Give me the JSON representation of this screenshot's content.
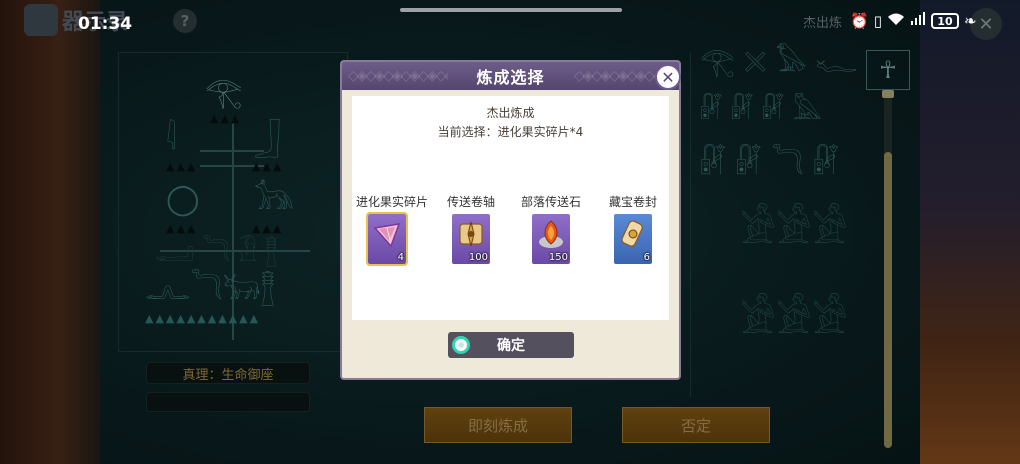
{
  "status_bar": {
    "time": "01:34",
    "battery": "10"
  },
  "background": {
    "title": "器示录",
    "help": "?",
    "close": "✕",
    "top_right_text": "杰出炼",
    "truth_label": "真理：生命御座",
    "left_button": "即刻炼成",
    "right_button": "否定"
  },
  "dialog": {
    "title": "炼成选择",
    "subtitle": "杰出炼成",
    "current_selection": "当前选择：进化果实碎片*4",
    "items": [
      {
        "name": "进化果实碎片",
        "count": "4",
        "icon": "fruit-shard-icon",
        "selected": true
      },
      {
        "name": "传送卷轴",
        "count": "100",
        "icon": "teleport-scroll-icon",
        "selected": false
      },
      {
        "name": "部落传送石",
        "count": "150",
        "icon": "tribe-teleport-stone-icon",
        "selected": false
      },
      {
        "name": "藏宝卷封",
        "count": "6",
        "icon": "treasure-scroll-icon",
        "selected": false
      }
    ],
    "confirm_label": "确定"
  },
  "colors": {
    "header": "#6d5c8a",
    "panel": "#efe9d9",
    "accent_teal": "#2fd6b0",
    "gold": "#c9a758"
  }
}
